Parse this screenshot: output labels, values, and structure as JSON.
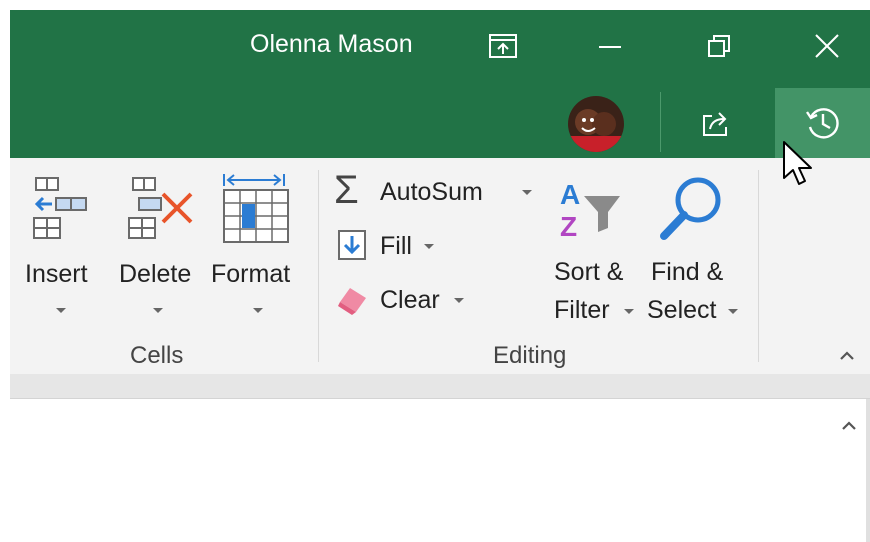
{
  "titlebar": {
    "user_name": "Olenna Mason",
    "color": "#217346",
    "icons": [
      "ribbon-display-options-icon",
      "minimize-icon",
      "restore-icon",
      "close-icon",
      "share-icon",
      "history-icon"
    ]
  },
  "ribbon": {
    "groups": {
      "cells": {
        "label": "Cells",
        "insert": "Insert",
        "delete": "Delete",
        "format": "Format"
      },
      "editing": {
        "label": "Editing",
        "autosum": "AutoSum",
        "fill": "Fill",
        "clear": "Clear",
        "sort_line1": "Sort &",
        "sort_line2": "Filter",
        "find_line1": "Find &",
        "find_line2": "Select"
      }
    }
  }
}
